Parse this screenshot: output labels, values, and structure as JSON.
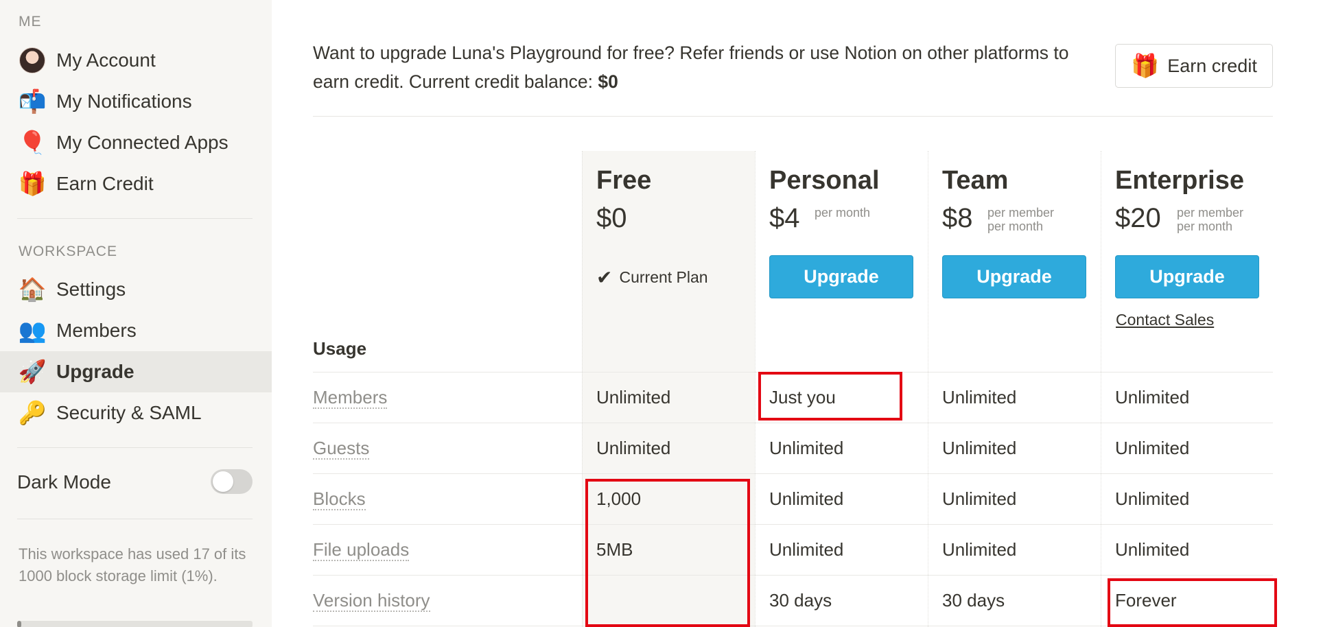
{
  "sidebar": {
    "me_label": "ME",
    "me_items": [
      {
        "label": "My Account",
        "icon": "avatar"
      },
      {
        "label": "My Notifications",
        "icon": "mailbox-icon"
      },
      {
        "label": "My Connected Apps",
        "icon": "balloon-icon"
      },
      {
        "label": "Earn Credit",
        "icon": "gift-icon"
      }
    ],
    "workspace_label": "WORKSPACE",
    "workspace_items": [
      {
        "label": "Settings",
        "icon": "house-icon"
      },
      {
        "label": "Members",
        "icon": "people-icon"
      },
      {
        "label": "Upgrade",
        "icon": "rocket-icon",
        "active": true
      },
      {
        "label": "Security & SAML",
        "icon": "key-icon"
      }
    ],
    "dark_mode_label": "Dark Mode",
    "dark_mode_on": false,
    "usage_text": "This workspace has used 17 of its 1000 block storage limit (1%).",
    "usage_fraction": 0.017
  },
  "credit": {
    "text_before": "Want to upgrade Luna's Playground for free? Refer friends or use Notion on other platforms to earn credit. Current credit balance: ",
    "balance": "$0",
    "earn_button": "Earn credit"
  },
  "plans": [
    {
      "name": "Free",
      "price": "$0",
      "period_1": "",
      "period_2": "",
      "status": "Current Plan"
    },
    {
      "name": "Personal",
      "price": "$4",
      "period_1": "per month",
      "period_2": "",
      "button": "Upgrade"
    },
    {
      "name": "Team",
      "price": "$8",
      "period_1": "per member",
      "period_2": "per month",
      "button": "Upgrade"
    },
    {
      "name": "Enterprise",
      "price": "$20",
      "period_1": "per member",
      "period_2": "per month",
      "button": "Upgrade",
      "link": "Contact Sales"
    }
  ],
  "usage_header": "Usage",
  "features": [
    {
      "label": "Members",
      "values": [
        "Unlimited",
        "Just you",
        "Unlimited",
        "Unlimited"
      ]
    },
    {
      "label": "Guests",
      "values": [
        "Unlimited",
        "Unlimited",
        "Unlimited",
        "Unlimited"
      ]
    },
    {
      "label": "Blocks",
      "values": [
        "1,000",
        "Unlimited",
        "Unlimited",
        "Unlimited"
      ]
    },
    {
      "label": "File uploads",
      "values": [
        "5MB",
        "Unlimited",
        "Unlimited",
        "Unlimited"
      ]
    },
    {
      "label": "Version history",
      "values": [
        "",
        "30 days",
        "30 days",
        "Forever"
      ]
    }
  ],
  "colors": {
    "accent": "#2eaadc",
    "highlight": "#e30613",
    "sidebar_bg": "#f7f6f3"
  }
}
